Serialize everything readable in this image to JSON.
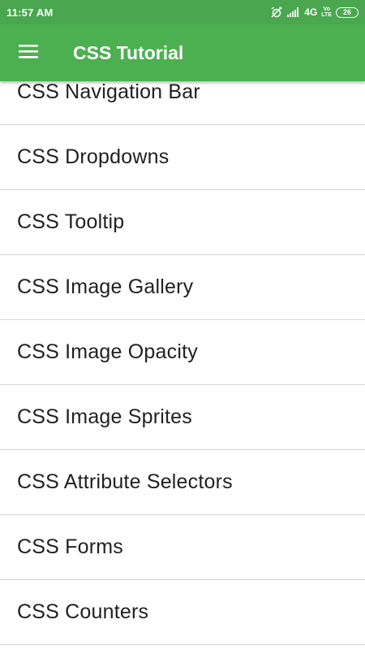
{
  "status_bar": {
    "time": "11:57 AM",
    "network": "4G",
    "volte_top": "Vo",
    "volte_bottom": "LTE",
    "battery": "26"
  },
  "app_bar": {
    "menu_icon": "hamburger-menu-icon",
    "title": "CSS Tutorial"
  },
  "list": {
    "items": [
      {
        "label": "CSS Navigation Bar"
      },
      {
        "label": "CSS Dropdowns"
      },
      {
        "label": "CSS Tooltip"
      },
      {
        "label": "CSS Image Gallery"
      },
      {
        "label": "CSS Image Opacity"
      },
      {
        "label": "CSS Image Sprites"
      },
      {
        "label": "CSS Attribute Selectors"
      },
      {
        "label": "CSS Forms"
      },
      {
        "label": "CSS Counters"
      }
    ]
  },
  "colors": {
    "status_bar": "#4aa64f",
    "app_bar": "#4caf50",
    "divider": "#d6d6d6",
    "text": "#212121"
  }
}
